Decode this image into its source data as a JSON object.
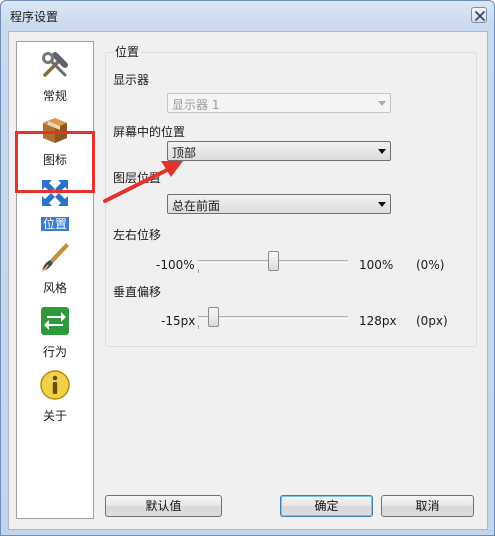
{
  "window": {
    "title": "程序设置"
  },
  "sidebar": {
    "items": [
      {
        "label": "常规",
        "icon": "tools-icon"
      },
      {
        "label": "图标",
        "icon": "package-icon"
      },
      {
        "label": "位置",
        "icon": "move-arrows-icon",
        "selected": true
      },
      {
        "label": "风格",
        "icon": "brush-icon"
      },
      {
        "label": "行为",
        "icon": "exchange-arrows-icon"
      },
      {
        "label": "关于",
        "icon": "info-icon"
      }
    ]
  },
  "position_group": {
    "title": "位置",
    "display_label": "显示器",
    "display_value": "显示器 1",
    "screen_position_label": "屏幕中的位置",
    "screen_position_value": "顶部",
    "layer_label": "图层位置",
    "layer_value": "总在前面",
    "horizontal": {
      "label": "左右位移",
      "min": "-100%",
      "max": "100%",
      "current": "(0%)",
      "value_fraction": 0.5
    },
    "vertical": {
      "label": "垂直偏移",
      "min": "-15px",
      "max": "128px",
      "current": "(0px)",
      "value_fraction": 0.105
    }
  },
  "buttons": {
    "defaults": "默认值",
    "ok": "确定",
    "cancel": "取消"
  },
  "colors": {
    "highlight": "#e5322d",
    "selection": "#3a7bd5"
  }
}
